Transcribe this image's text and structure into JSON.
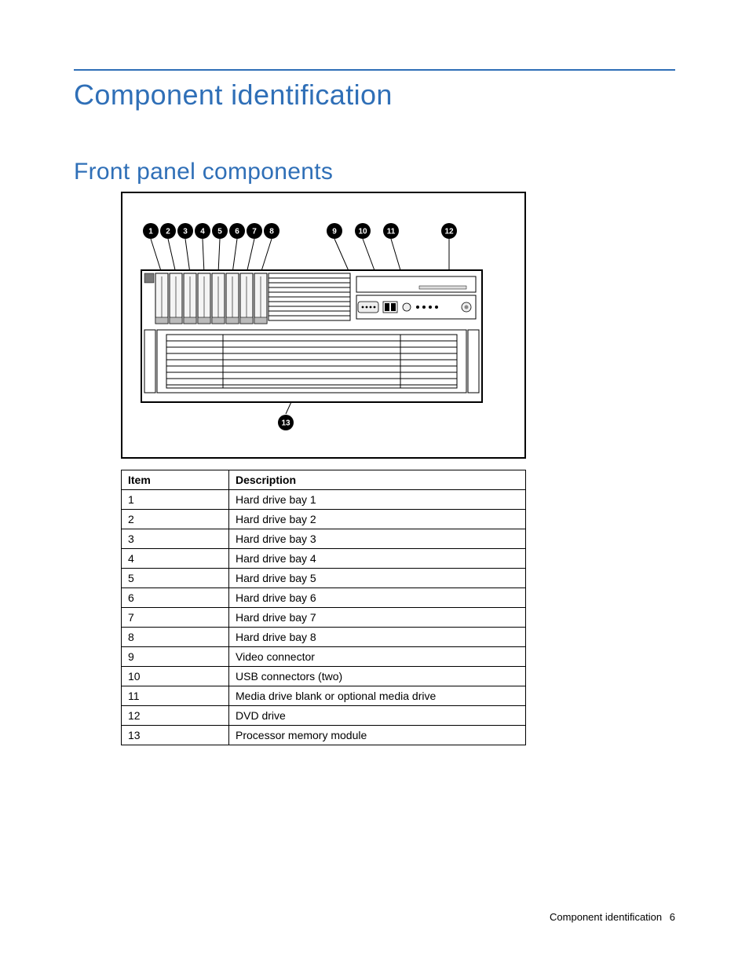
{
  "headings": {
    "h1": "Component identification",
    "h2": "Front panel components"
  },
  "diagram": {
    "callouts": [
      "1",
      "2",
      "3",
      "4",
      "5",
      "6",
      "7",
      "8",
      "9",
      "10",
      "11",
      "12",
      "13"
    ]
  },
  "table": {
    "headers": [
      "Item",
      "Description"
    ],
    "rows": [
      [
        "1",
        "Hard drive bay 1"
      ],
      [
        "2",
        "Hard drive bay 2"
      ],
      [
        "3",
        "Hard drive bay 3"
      ],
      [
        "4",
        "Hard drive bay 4"
      ],
      [
        "5",
        "Hard drive bay 5"
      ],
      [
        "6",
        "Hard drive bay 6"
      ],
      [
        "7",
        "Hard drive bay 7"
      ],
      [
        "8",
        "Hard drive bay 8"
      ],
      [
        "9",
        "Video connector"
      ],
      [
        "10",
        "USB connectors (two)"
      ],
      [
        "11",
        "Media drive blank or optional media drive"
      ],
      [
        "12",
        "DVD drive"
      ],
      [
        "13",
        "Processor memory module"
      ]
    ]
  },
  "footer": {
    "section": "Component identification",
    "page_number": "6"
  }
}
